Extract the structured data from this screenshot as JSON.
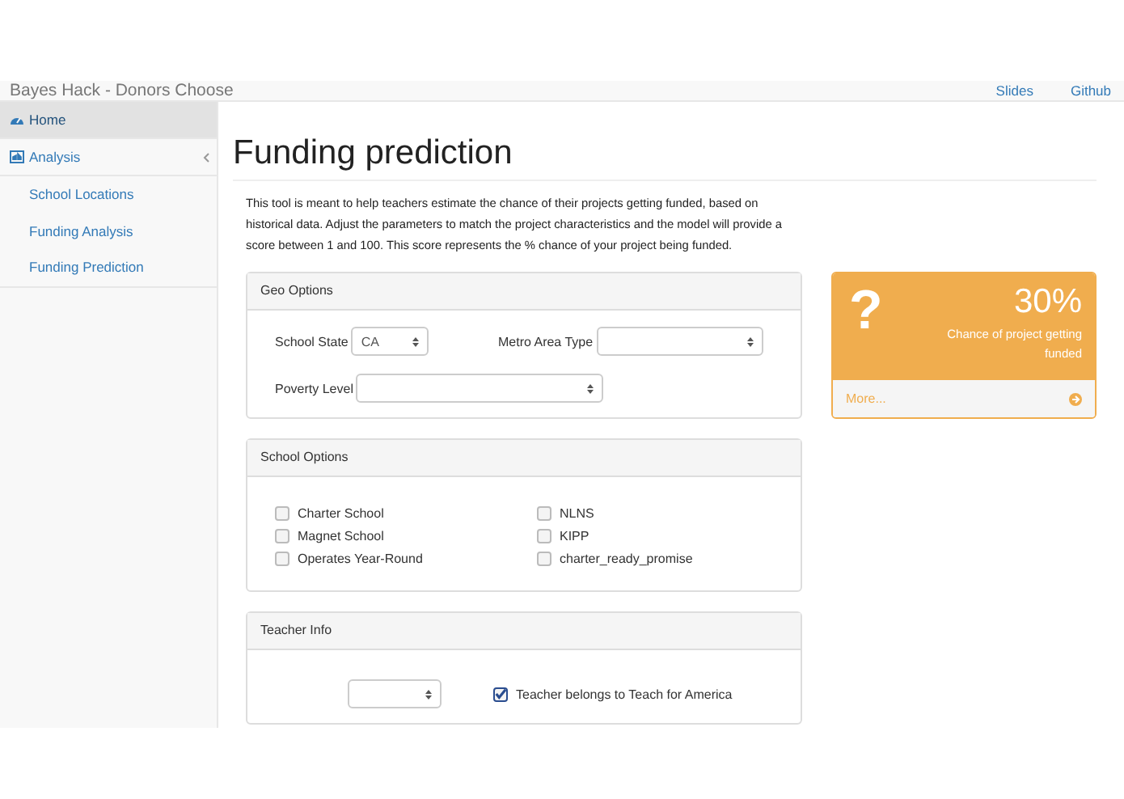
{
  "navbar": {
    "brand": "Bayes Hack - Donors Choose",
    "links": [
      "Slides",
      "Github"
    ]
  },
  "sidebar": {
    "items": [
      {
        "label": "Home",
        "selected": true
      },
      {
        "label": "Analysis",
        "selected": false,
        "children": [
          {
            "label": "School Locations",
            "selected": false
          },
          {
            "label": "Funding Analysis",
            "selected": false
          },
          {
            "label": "Funding Prediction",
            "selected": false
          }
        ]
      }
    ]
  },
  "page": {
    "title": "Funding prediction",
    "intro": "This tool is meant to help teachers estimate the chance of their projects getting funded, based on historical data. Adjust the parameters to match the project characteristics and the model will provide a score between 1 and 100. This score represents the % chance of your project being funded."
  },
  "panels": [
    {
      "title": "Geo Options",
      "kind": "selects",
      "fields": [
        {
          "label": "School State",
          "value": "CA"
        },
        {
          "label": "Metro Area Type"
        },
        {
          "label": "Poverty Level"
        }
      ]
    },
    {
      "title": "School Options",
      "kind": "checkboxes",
      "fields": [
        {
          "label": "Charter School",
          "checked": false
        },
        {
          "label": "Magnet School",
          "checked": false
        },
        {
          "label": "Operates Year-Round",
          "checked": false
        },
        {
          "label": "NLNS",
          "checked": false
        },
        {
          "label": "KIPP",
          "checked": false
        },
        {
          "label": "charter_ready_promise",
          "checked": false
        }
      ]
    },
    {
      "title": "Teacher Info",
      "kind": "teacher",
      "fields": [
        {
          "kind": "select"
        },
        {
          "kind": "checkbox",
          "label": "Teacher belongs to Teach for America",
          "checked": true
        }
      ]
    }
  ],
  "result": {
    "symbol": "?",
    "value": "30%",
    "caption": "Chance of project getting funded",
    "footer": "More..."
  }
}
